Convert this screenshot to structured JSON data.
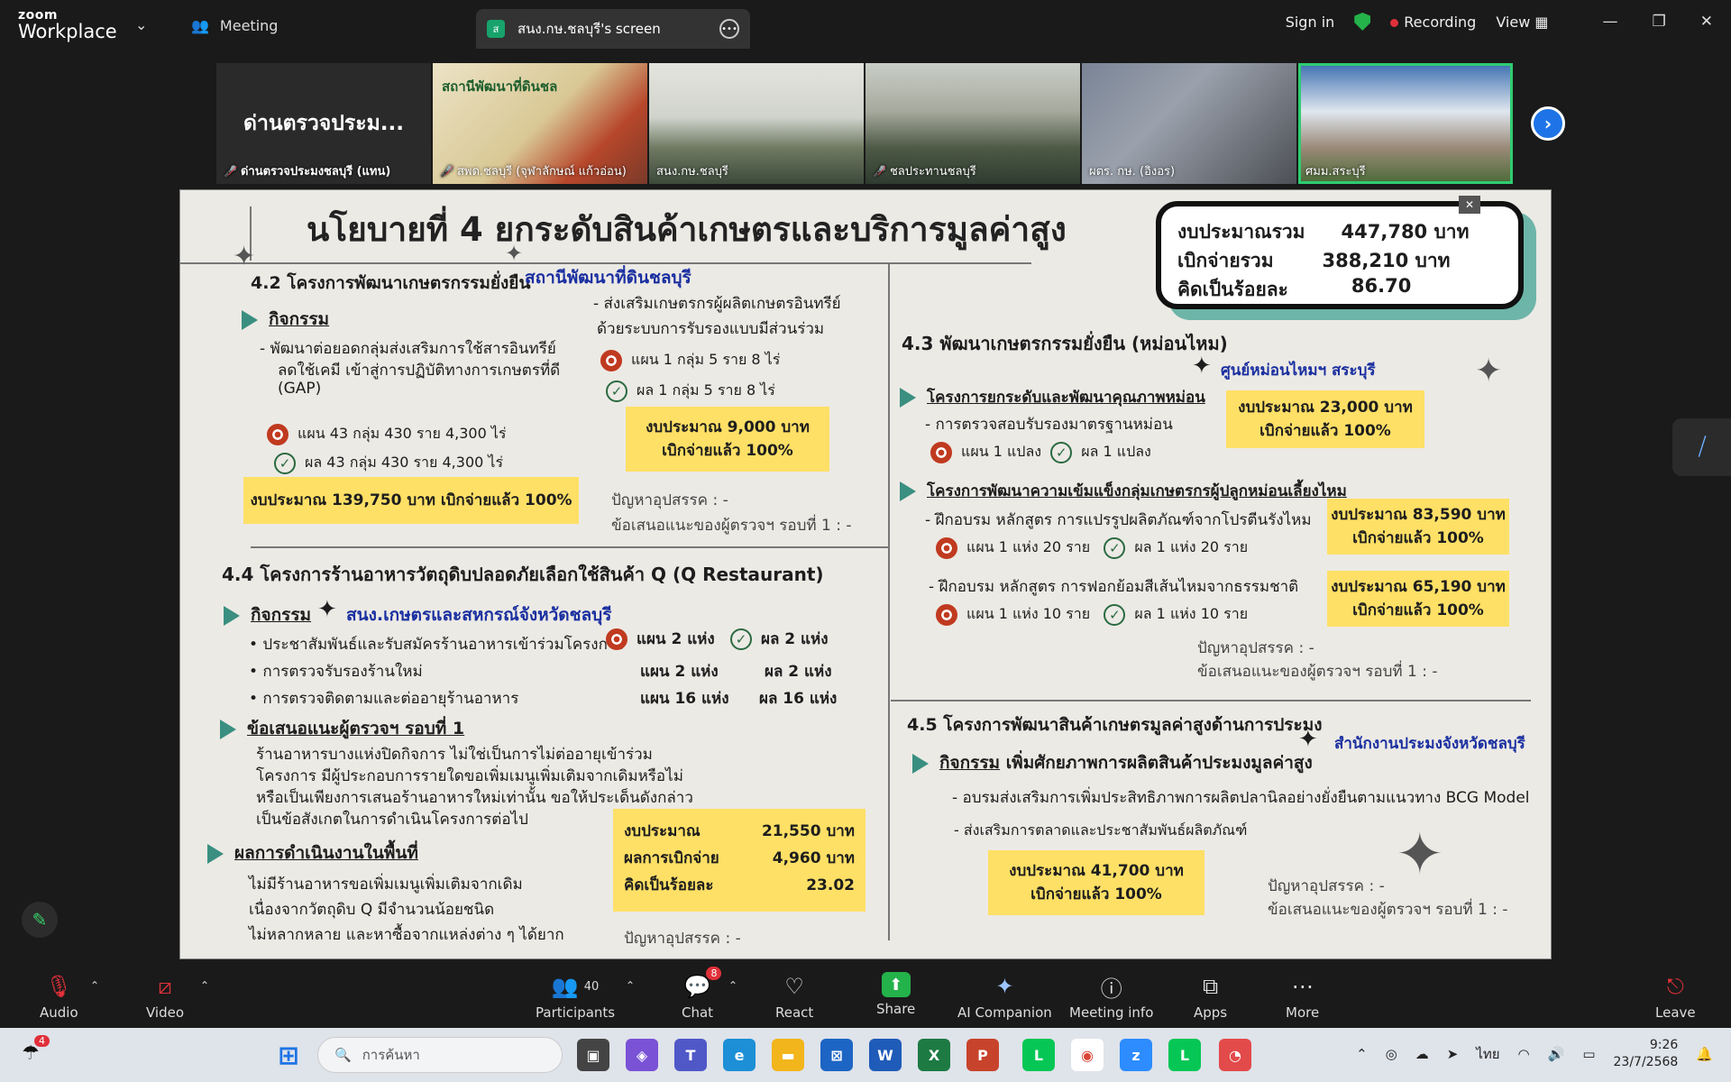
{
  "app": {
    "brand_small": "zoom",
    "brand_large": "Workplace"
  },
  "topbar": {
    "meeting_label": "Meeting",
    "screen_tab_initial": "ส",
    "screen_tab_label": "สนง.กษ.ชลบุรี's screen",
    "sign_in": "Sign in",
    "recording": "Recording",
    "view": "View"
  },
  "thumbnails": [
    {
      "name": "ด่านตรวจประมงชลบุรี (แทน)",
      "display": "ด่านตรวจประม...",
      "muted": true
    },
    {
      "name": "สพด.ชลบุรี (จุฬาลักษณ์ แก้วอ่อน)",
      "display": "สถานีพัฒนาที่ดินชล",
      "muted": true
    },
    {
      "name": "สนง.กษ.ชลบุรี",
      "muted": false
    },
    {
      "name": "ชลประทานชลบุรี",
      "muted": true
    },
    {
      "name": "ผตร. กษ. (อิงอร)",
      "muted": false
    },
    {
      "name": "ศมม.สระบุรี",
      "muted": false
    }
  ],
  "slide": {
    "title": "นโยบายที่ 4 ยกระดับสินค้าเกษตรและบริการมูลค่าสูง",
    "budget_summary": [
      {
        "label": "งบประมาณรวม",
        "value": "447,780 บาท"
      },
      {
        "label": "เบิกจ่ายรวม",
        "value": "388,210 บาท"
      },
      {
        "label": "คิดเป็นร้อยละ",
        "value": "86.70"
      }
    ],
    "s42": {
      "heading": "4.2 โครงการพัฒนาเกษตรกรรมยั่งยืน",
      "agency": "สถานีพัฒนาที่ดินชลบุรี",
      "activity": "กิจกรรม",
      "item1a": "- พัฒนาต่อยอดกลุ่มส่งเสริมการใช้สารอินทรีย์",
      "item1b": "ลดใช้เคมี เข้าสู่การปฏิบัติทางการเกษตรที่ดี",
      "item1c": "(GAP)",
      "plan1": "แผน 43 กลุ่ม  430 ราย 4,300 ไร่",
      "result1": "ผล 43 กลุ่ม  430 ราย 4,300 ไร่",
      "budget1": "งบประมาณ 139,750  บาท เบิกจ่ายแล้ว 100%",
      "item2a": "- ส่งเสริมเกษตรกรผู้ผลิตเกษตรอินทรีย์",
      "item2b": "ด้วยระบบการรับรองแบบมีส่วนร่วม",
      "plan2": "แผน   1 กลุ่ม   5 ราย    8 ไร่",
      "result2": "ผล    1 กลุ่ม   5 ราย    8 ไร่",
      "budget2a": "งบประมาณ 9,000  บาท",
      "budget2b": "เบิกจ่ายแล้ว 100%",
      "problem": "ปัญหาอุปสรรค : -",
      "suggest": "ข้อเสนอแนะของผู้ตรวจฯ รอบที่ 1 : -"
    },
    "s43": {
      "heading": "4.3 พัฒนาเกษตรกรรมยั่งยืน (หม่อนไหม)",
      "agency": "ศูนย์หม่อนไหมฯ สระบุรี",
      "p1": "โครงการยกระดับและพัฒนาคุณภาพหม่อน",
      "p1a": "- การตรวจสอบรับรองมาตรฐานหม่อน",
      "p1plan": "แผน 1 แปลง",
      "p1result": "ผล 1 แปลง",
      "p1budget_a": "งบประมาณ 23,000 บาท",
      "p1budget_b": "เบิกจ่ายแล้ว 100%",
      "p2": "โครงการพัฒนาความเข้มแข็งกลุ่มเกษตรกรผู้ปลูกหม่อนเลี้ยงไหม",
      "p2a": "- ฝึกอบรม หลักสูตร การแปรรูปผลิตภัณฑ์จากโปรตีนรังไหม",
      "p2a_plan": "แผน 1 แห่ง 20 ราย",
      "p2a_result": "ผล 1 แห่ง 20 ราย",
      "p2a_budget_a": "งบประมาณ 83,590 บาท",
      "p2a_budget_b": "เบิกจ่ายแล้ว 100%",
      "p2b": "- ฝึกอบรม หลักสูตร การฟอกย้อมสีเส้นไหมจากธรรมชาติ",
      "p2b_plan": "แผน 1 แห่ง 10 ราย",
      "p2b_result": "ผล   1 แห่ง 10 ราย",
      "p2b_budget_a": "งบประมาณ 65,190 บาท",
      "p2b_budget_b": "เบิกจ่ายแล้ว 100%",
      "problem": "ปัญหาอุปสรรค : -",
      "suggest": "ข้อเสนอแนะของผู้ตรวจฯ รอบที่ 1 : -"
    },
    "s44": {
      "heading": "4.4 โครงการร้านอาหารวัตถุดิบปลอดภัยเลือกใช้สินค้า Q (Q Restaurant)",
      "activity": "กิจกรรม",
      "agency": "สนง.เกษตรและสหกรณ์จังหวัดชลบุรี",
      "rows": [
        {
          "item": "•  ประชาสัมพันธ์และรับสมัครร้านอาหารเข้าร่วมโครงการ",
          "plan": "แผน 2 แห่ง",
          "result": "ผล 2 แห่ง"
        },
        {
          "item": "•  การตรวจรับรองร้านใหม่",
          "plan": "แผน 2 แห่ง",
          "result": "ผล 2 แห่ง"
        },
        {
          "item": "•  การตรวจติดตามและต่ออายุร้านอาหาร",
          "plan": "แผน 16 แห่ง",
          "result": "ผล 16 แห่ง"
        }
      ],
      "suggest_head": "ข้อเสนอแนะผู้ตรวจฯ รอบที่ 1",
      "suggest_lines": [
        "ร้านอาหารบางแห่งปิดกิจการ ไม่ใช่เป็นการไม่ต่ออายุเข้าร่วม",
        "โครงการ มีผู้ประกอบการรายใดขอเพิ่มเมนูเพิ่มเติมจากเดิมหรือไม่",
        " หรือเป็นเพียงการเสนอร้านอาหารใหม่เท่านั้น ขอให้ประเด็นดังกล่าว",
        "เป็นข้อสังเกตในการดำเนินโครงการต่อไป"
      ],
      "result_head": "ผลการดำเนินงานในพื้นที่",
      "result_lines": [
        "ไม่มีร้านอาหารขอเพิ่มเมนูเพิ่มเติมจากเดิม",
        "เนื่องจากวัตถุดิบ Q มีจำนวนน้อยชนิด",
        "ไม่หลากหลาย และหาซื้อจากแหล่งต่าง ๆ ได้ยาก"
      ],
      "budget": [
        {
          "label": "งบประมาณ",
          "value": "21,550 บาท"
        },
        {
          "label": "ผลการเบิกจ่าย",
          "value": "4,960 บาท"
        },
        {
          "label": "คิดเป็นร้อยละ",
          "value": "23.02"
        }
      ],
      "problem": "ปัญหาอุปสรรค : -"
    },
    "s45": {
      "heading": "4.5 โครงการพัฒนาสินค้าเกษตรมูลค่าสูงด้านการประมง",
      "agency": "สำนักงานประมงจังหวัดชลบุรี",
      "activity": "กิจกรรม",
      "activity_rest": " เพิ่มศักยภาพการผลิตสินค้าประมงมูลค่าสูง",
      "item1": "- อบรมส่งเสริมการเพิ่มประสิทธิภาพการผลิตปลานิลอย่างยั่งยืนตามแนวทาง BCG Model",
      "item2": "- ส่งเสริมการตลาดและประชาสัมพันธ์ผลิตภัณฑ์",
      "budget_a": "งบประมาณ  41,700 บาท",
      "budget_b": "เบิกจ่ายแล้ว 100%",
      "problem": "ปัญหาอุปสรรค : -",
      "suggest": "ข้อเสนอแนะของผู้ตรวจฯ รอบที่ 1 : -"
    }
  },
  "controls": {
    "audio": "Audio",
    "video": "Video",
    "participants": "Participants",
    "participants_count": "40",
    "chat": "Chat",
    "chat_badge": "8",
    "react": "React",
    "share": "Share",
    "ai": "AI Companion",
    "info": "Meeting info",
    "apps": "Apps",
    "more": "More",
    "leave": "Leave"
  },
  "taskbar": {
    "weather_badge": "4",
    "search_placeholder": "การค้นหา",
    "lang": "ไทย",
    "time": "9:26",
    "date": "23/7/2568"
  },
  "colors": {
    "accent_green": "#24b24a",
    "zoom_blue": "#1e74e6",
    "highlight_yellow": "#ffe066",
    "title_blue": "#1a2fa0"
  }
}
